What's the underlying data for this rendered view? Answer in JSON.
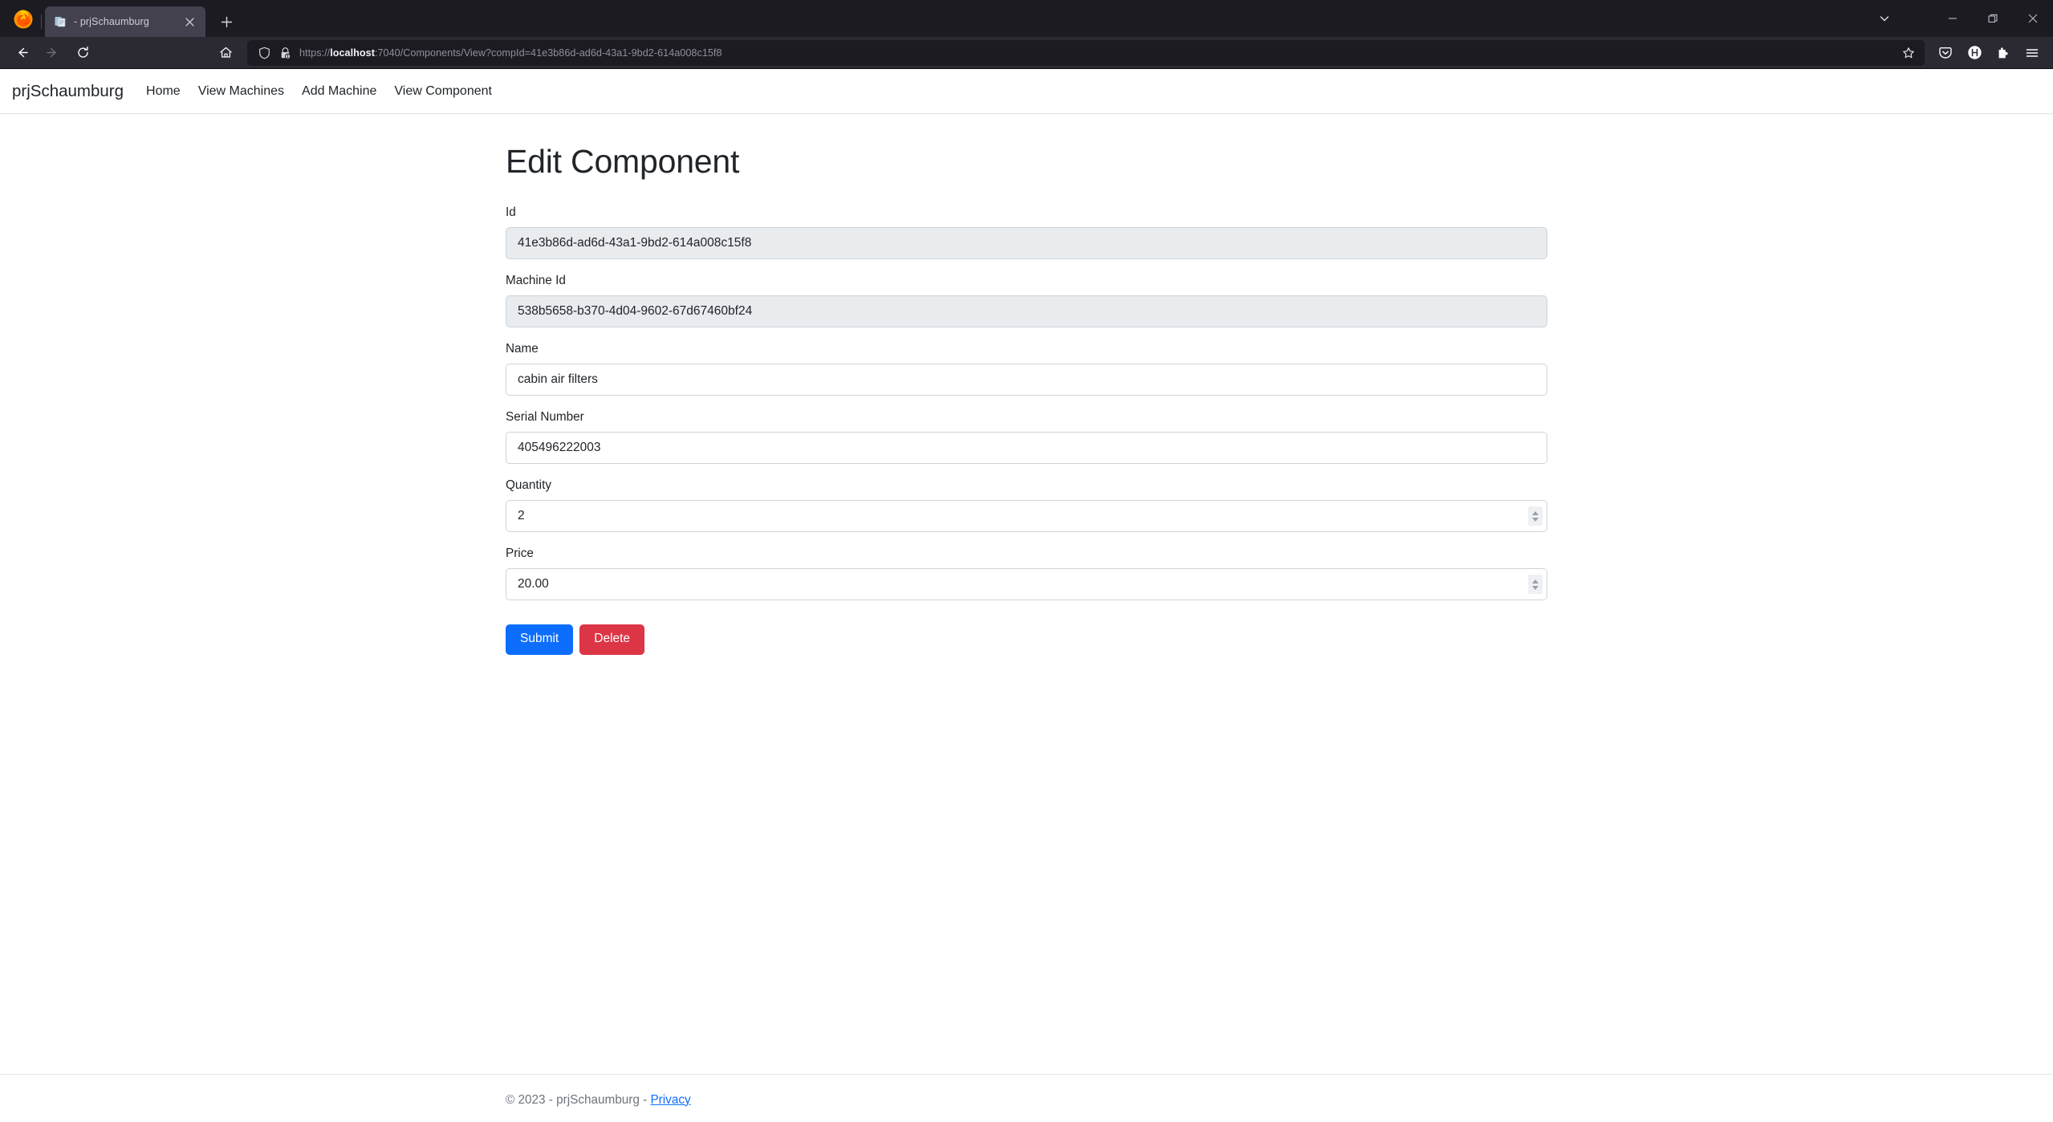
{
  "browser": {
    "tab": {
      "title": "- prjSchaumburg",
      "favicon": "document-icon",
      "close_icon": "close-icon"
    },
    "new_tab_icon": "plus-icon",
    "list_all_tabs_icon": "chevron-down-icon",
    "window_controls": {
      "minimize": "minimize-icon",
      "restore": "restore-icon",
      "close": "close-icon"
    },
    "toolbar": {
      "back_icon": "back-arrow-icon",
      "forward_icon": "forward-arrow-icon",
      "reload_icon": "reload-icon",
      "home_icon": "home-icon",
      "shield_icon": "shield-icon",
      "lock_warning_icon": "lock-warning-icon",
      "bookmark_icon": "star-icon",
      "pocket_icon": "pocket-icon",
      "account_icon": "account-h-icon",
      "extensions_icon": "extensions-puzzle-icon",
      "app_menu_icon": "hamburger-menu-icon"
    },
    "url": {
      "scheme": "https://",
      "host": "localhost",
      "rest": ":7040/Components/View?compId=41e3b86d-ad6d-43a1-9bd2-614a008c15f8",
      "full": "https://localhost:7040/Components/View?compId=41e3b86d-ad6d-43a1-9bd2-614a008c15f8"
    }
  },
  "site": {
    "brand": "prjSchaumburg",
    "nav_links": [
      {
        "label": "Home"
      },
      {
        "label": "View Machines"
      },
      {
        "label": "Add Machine"
      },
      {
        "label": "View Component"
      }
    ]
  },
  "page": {
    "title": "Edit Component",
    "fields": [
      {
        "label": "Id",
        "value": "41e3b86d-ad6d-43a1-9bd2-614a008c15f8",
        "readonly": true,
        "type": "text"
      },
      {
        "label": "Machine Id",
        "value": "538b5658-b370-4d04-9602-67d67460bf24",
        "readonly": true,
        "type": "text"
      },
      {
        "label": "Name",
        "value": "cabin air filters",
        "readonly": false,
        "type": "text"
      },
      {
        "label": "Serial Number",
        "value": "405496222003",
        "readonly": false,
        "type": "text"
      },
      {
        "label": "Quantity",
        "value": "2",
        "readonly": false,
        "type": "number"
      },
      {
        "label": "Price",
        "value": "20.00",
        "readonly": false,
        "type": "number"
      }
    ],
    "buttons": {
      "submit": "Submit",
      "delete": "Delete"
    },
    "colors": {
      "primary": "#0d6efd",
      "danger": "#dc3545",
      "readonly_bg": "#e9ecef"
    }
  },
  "footer": {
    "copyright": "© 2023 - prjSchaumburg - ",
    "privacy_label": "Privacy"
  }
}
